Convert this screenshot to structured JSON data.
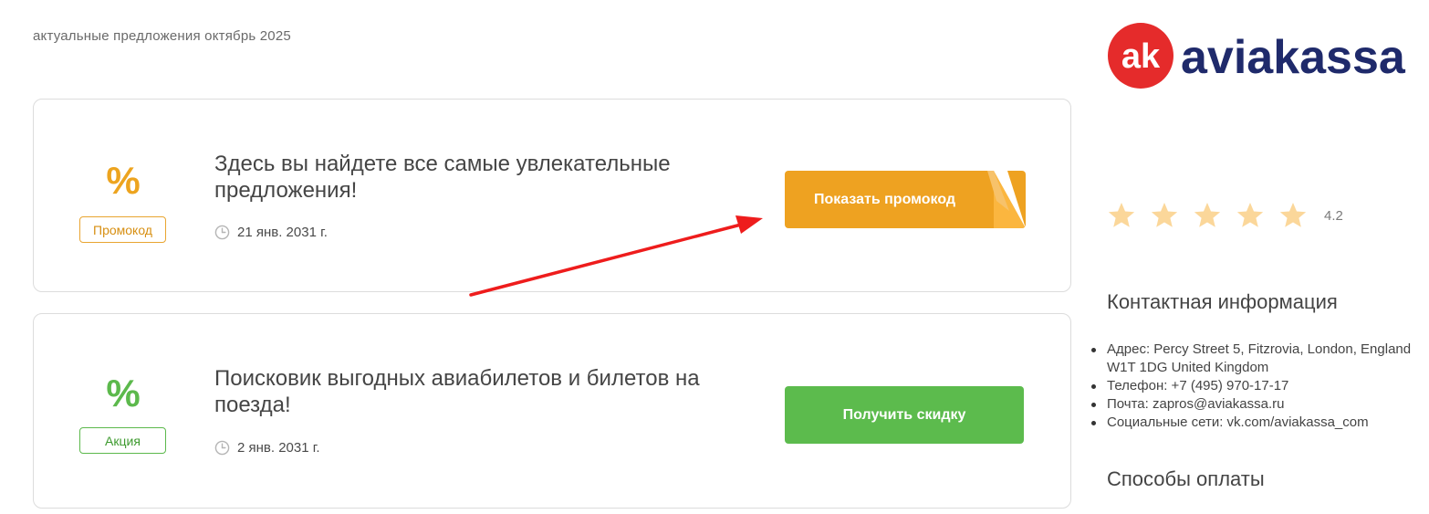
{
  "page": {
    "subtitle": "актуальные предложения октябрь 2025"
  },
  "brand": {
    "logo_mark": "ak",
    "logo_text": "aviakassa",
    "colors": {
      "red": "#e52b2b",
      "navy": "#1f2a6b"
    }
  },
  "offers": [
    {
      "percent_symbol": "%",
      "badge": "Промокод",
      "title": "Здесь вы найдете все самые увлекательные предложения!",
      "date": "21 янв. 2031 г.",
      "button_label": "Показать промокод",
      "accent": "#eea221"
    },
    {
      "percent_symbol": "%",
      "badge": "Акция",
      "title": "Поисковик выгодных авиабилетов и билетов на поезда!",
      "date": "2 янв. 2031 г.",
      "button_label": "Получить скидку",
      "accent": "#5cbb4d"
    }
  ],
  "rating": {
    "stars_total": 5,
    "value": "4.2"
  },
  "contacts": {
    "heading": "Контактная информация",
    "items": [
      "Адрес: Percy Street 5, Fitzrovia, London, England W1T 1DG United Kingdom",
      "Телефон: +7 (495) 970-17-17",
      "Почта: zapros@aviakassa.ru",
      "Социальные сети: vk.com/aviakassa_com"
    ]
  },
  "payment": {
    "heading": "Способы оплаты"
  },
  "icons": {
    "clock": "clock-icon",
    "star": "star-icon",
    "arrow": "red-arrow-annotation"
  }
}
